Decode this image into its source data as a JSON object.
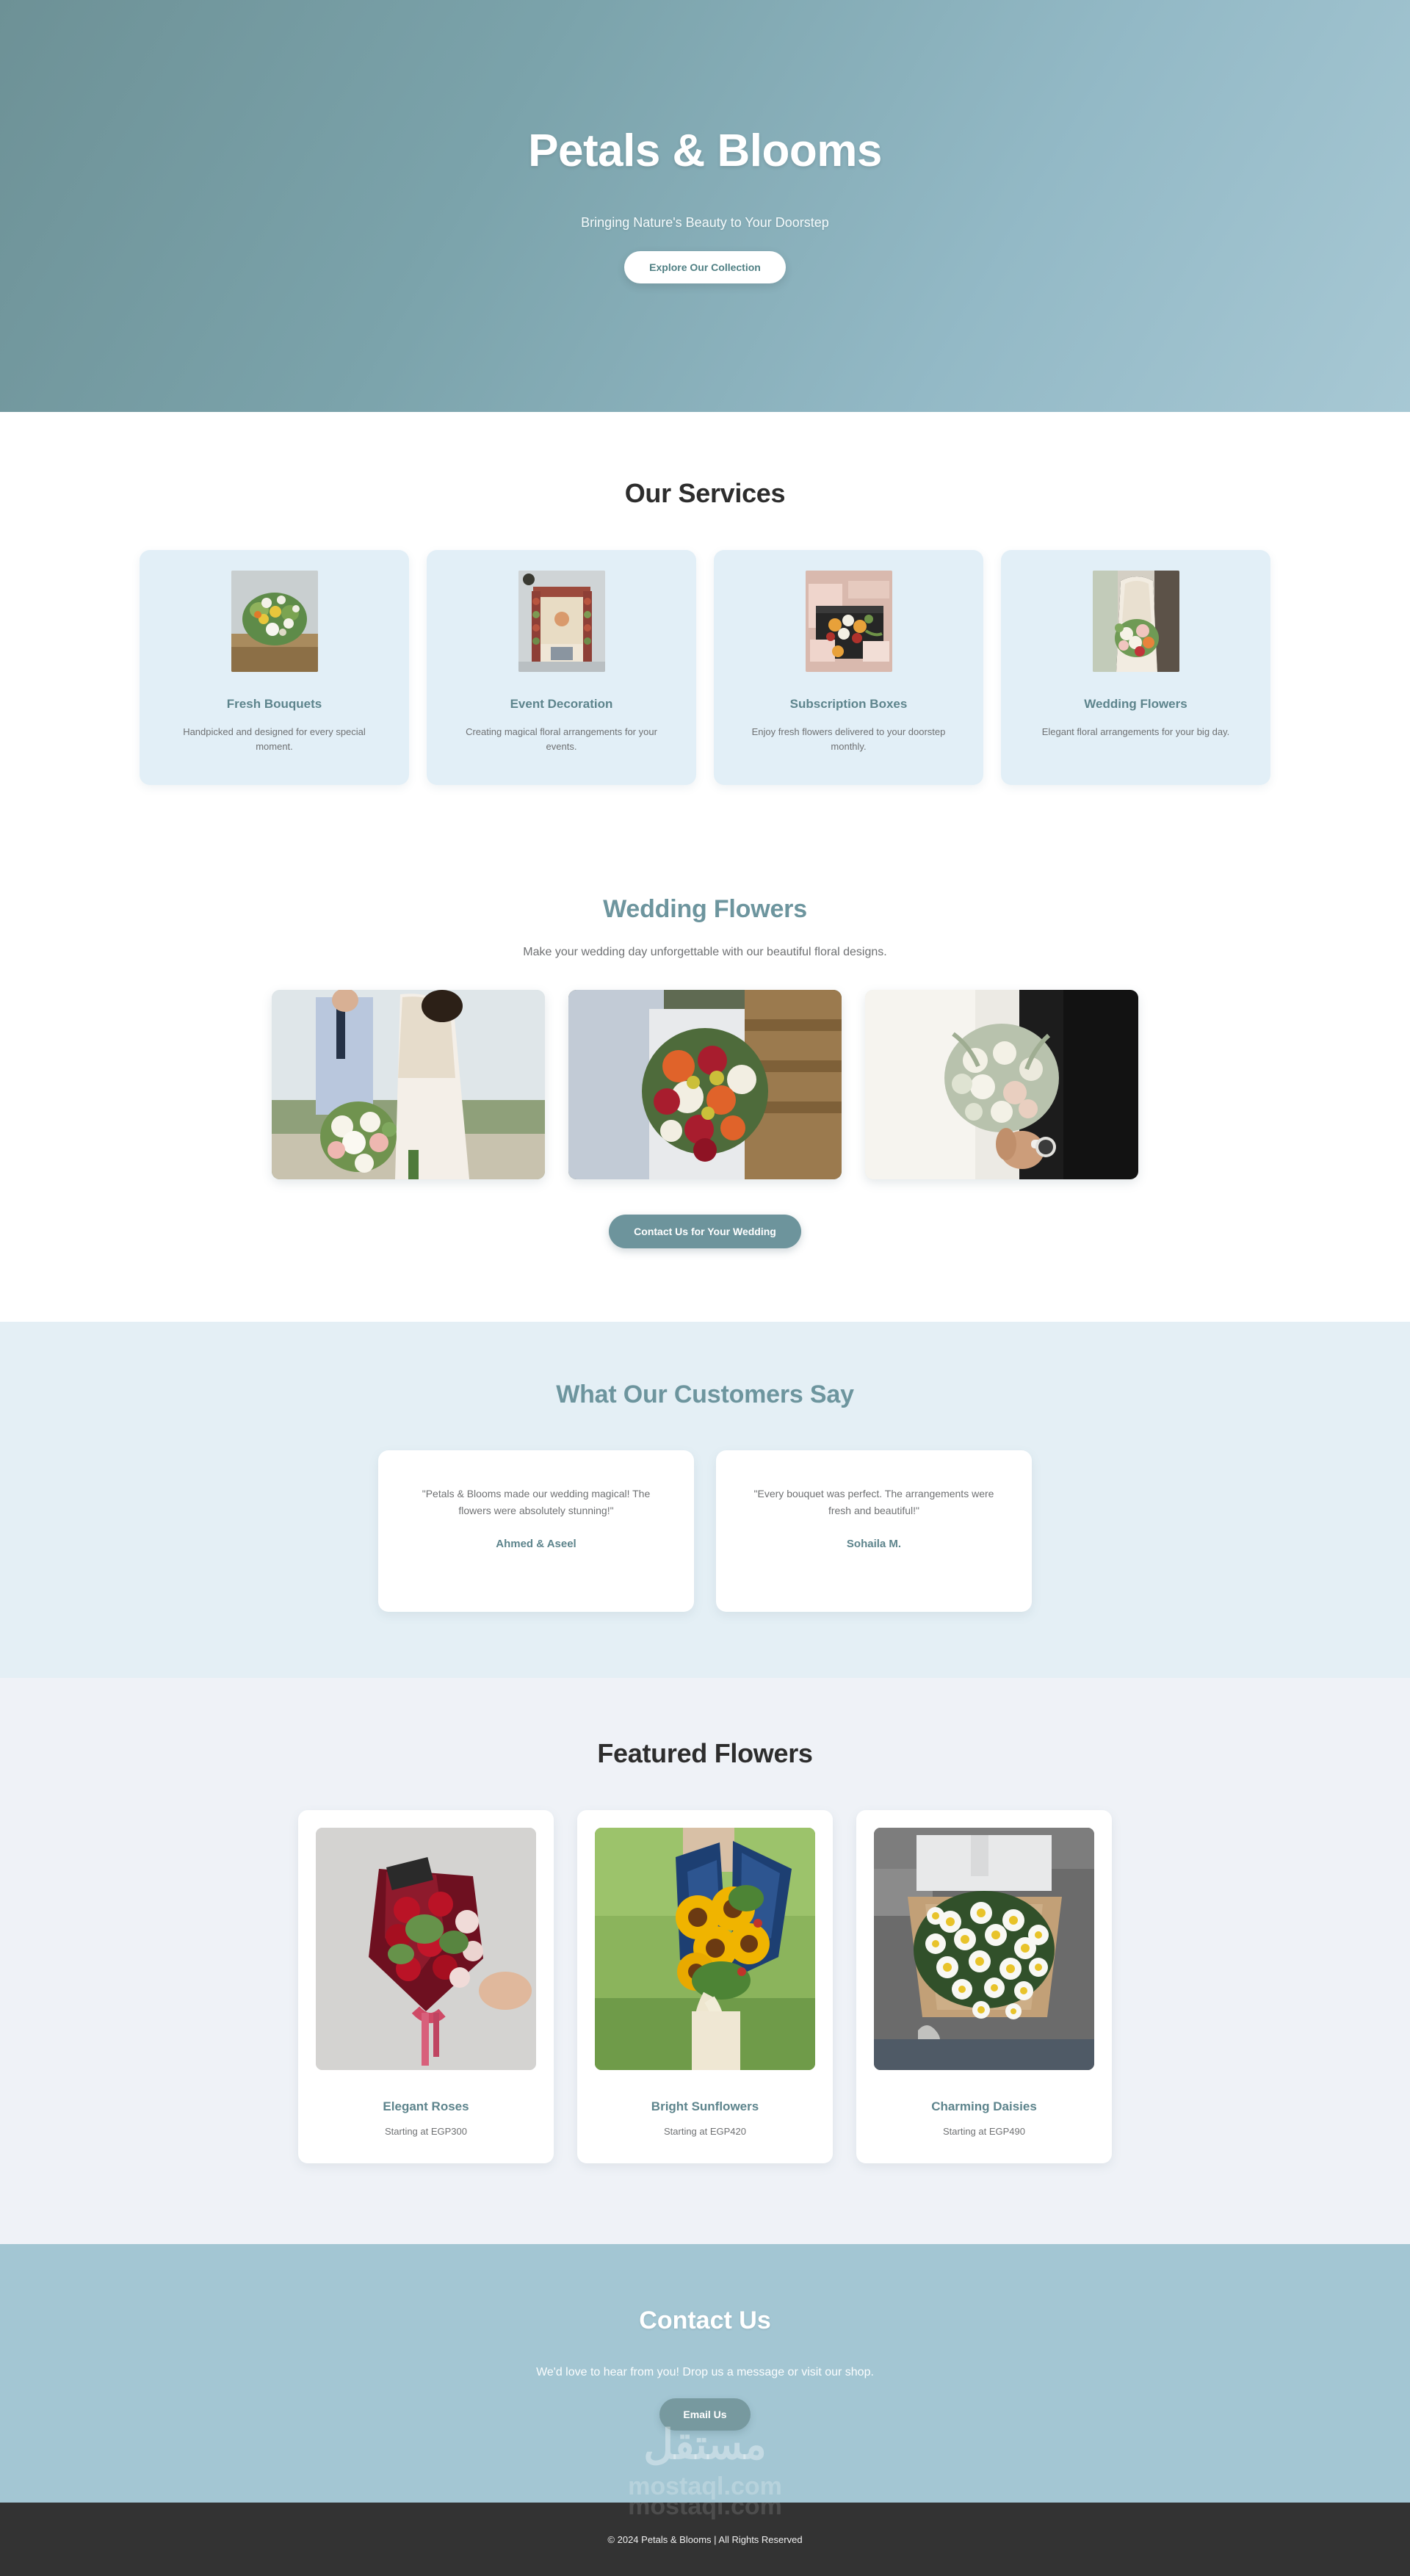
{
  "hero": {
    "title": "Petals & Blooms",
    "subtitle": "Bringing Nature's Beauty to Your Doorstep",
    "cta_label": "Explore Our Collection"
  },
  "services": {
    "title": "Our Services",
    "items": [
      {
        "name": "Fresh Bouquets",
        "description": "Handpicked and designed for every special moment.",
        "image_alt": "mixed-yellow-white-bouquet-photo"
      },
      {
        "name": "Event Decoration",
        "description": "Creating magical floral arrangements for your events.",
        "image_alt": "floral-wedding-mandap-arch-photo"
      },
      {
        "name": "Subscription Boxes",
        "description": "Enjoy fresh flowers delivered to your doorstep monthly.",
        "image_alt": "black-gift-box-with-flowers-photo"
      },
      {
        "name": "Wedding Flowers",
        "description": "Elegant floral arrangements for your big day.",
        "image_alt": "bride-in-lace-dress-holding-bouquet-photo"
      }
    ]
  },
  "wedding": {
    "title": "Wedding Flowers",
    "subtitle": "Make your wedding day unforgettable with our beautiful floral designs.",
    "cta_label": "Contact Us for Your Wedding",
    "gallery": [
      {
        "image_alt": "couple-outdoors-bride-white-pink-bouquet-photo"
      },
      {
        "image_alt": "bride-holding-red-orange-white-rose-bouquet-photo"
      },
      {
        "image_alt": "couple-in-white-and-black-with-white-eucalyptus-bouquet-photo"
      }
    ]
  },
  "testimonials": {
    "title": "What Our Customers Say",
    "items": [
      {
        "quote": "\"Petals & Blooms made our wedding magical! The flowers were absolutely stunning!\"",
        "author": "Ahmed & Aseel"
      },
      {
        "quote": "\"Every bouquet was perfect. The arrangements were fresh and beautiful!\"",
        "author": "Sohaila M."
      }
    ]
  },
  "featured": {
    "title": "Featured Flowers",
    "items": [
      {
        "name": "Elegant Roses",
        "price": "Starting at EGP300",
        "image_alt": "red-roses-in-burgundy-wrap-photo"
      },
      {
        "name": "Bright Sunflowers",
        "price": "Starting at EGP420",
        "image_alt": "sunflower-bouquet-in-blue-wrap-photo"
      },
      {
        "name": "Charming Daisies",
        "price": "Starting at EGP490",
        "image_alt": "white-daisies-in-kraft-paper-photo"
      }
    ]
  },
  "contact": {
    "title": "Contact Us",
    "subtitle": "We'd love to hear from you! Drop us a message or visit our shop.",
    "cta_label": "Email Us"
  },
  "watermark": {
    "arabic": "مستقل",
    "latin": "mostaql.com"
  },
  "footer": {
    "copyright": "© 2024 Petals & Blooms | All Rights Reserved"
  },
  "colors": {
    "hero_gradient_start": "#6d9196",
    "hero_gradient_end": "#a7c8d4",
    "accent_teal": "#6d959e",
    "service_card_bg": "#e2eff7",
    "testimonials_bg": "#e4eff5",
    "featured_bg": "#eff2f7",
    "contact_bg": "#a3c6d3",
    "footer_bg": "#333333",
    "body_text": "#6f7173",
    "heading_dark": "#2d2d2d"
  }
}
